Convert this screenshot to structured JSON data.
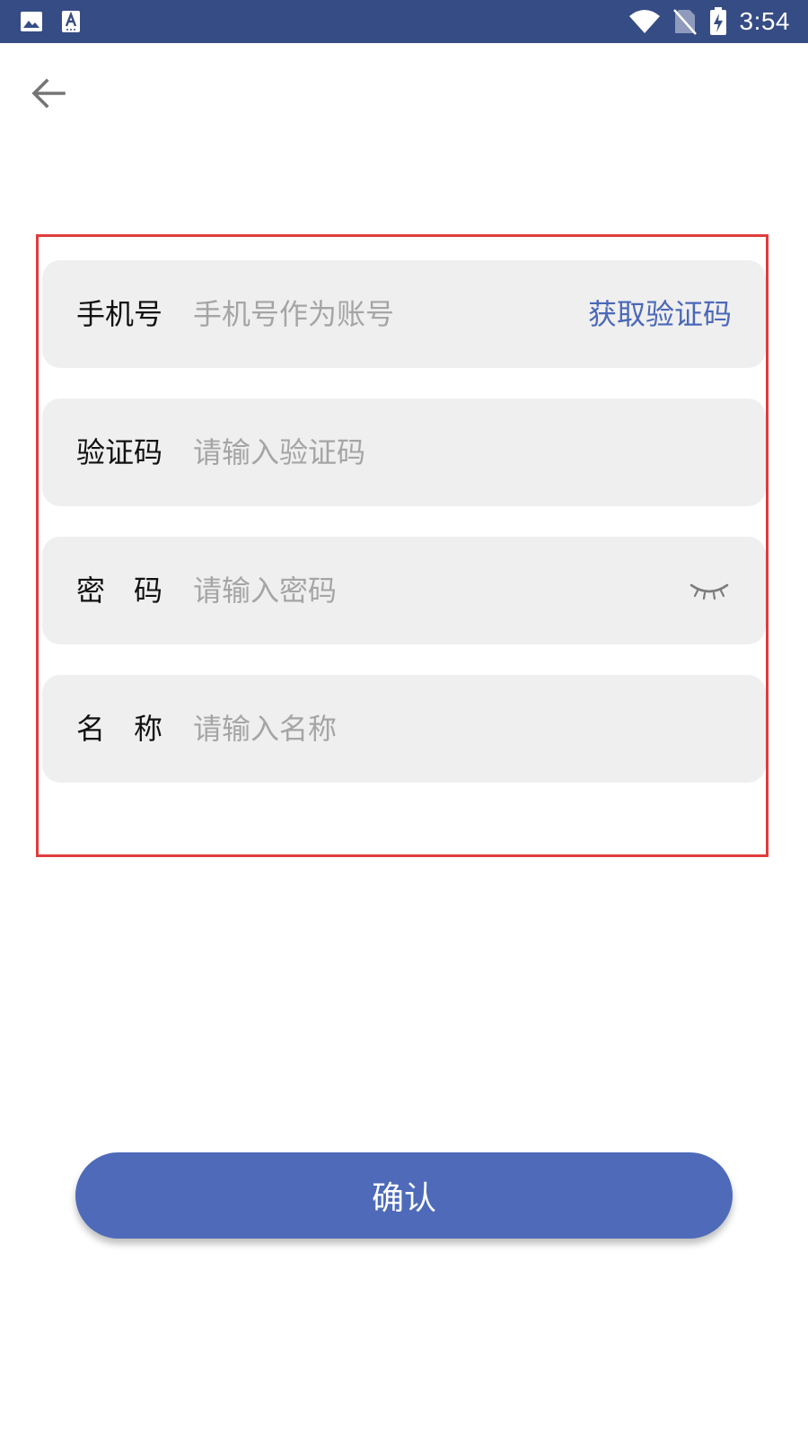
{
  "status_bar": {
    "time": "3:54",
    "icons": [
      "image-icon",
      "text-a-icon",
      "wifi-icon",
      "no-sim-icon",
      "battery-charging-icon"
    ]
  },
  "nav": {
    "back_icon": "arrow-left-icon"
  },
  "form": {
    "phone": {
      "label": "手机号",
      "placeholder": "手机号作为账号",
      "action_label": "获取验证码"
    },
    "code": {
      "label": "验证码",
      "placeholder": "请输入验证码"
    },
    "password": {
      "label": "密码",
      "placeholder": "请输入密码",
      "toggle_icon": "eye-closed-icon"
    },
    "name": {
      "label": "名称",
      "placeholder": "请输入名称"
    }
  },
  "confirm_button": {
    "label": "确认"
  },
  "colors": {
    "status_bar": "#364c84",
    "accent": "#4e6ab9",
    "link": "#4b68b8",
    "field_bg": "#efefef",
    "highlight_border": "#e03c3c"
  }
}
